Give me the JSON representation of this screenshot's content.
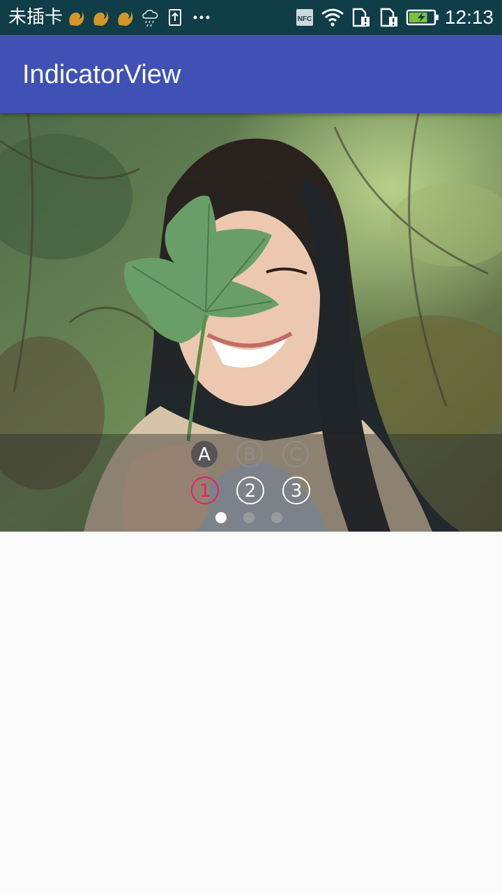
{
  "status_bar": {
    "carrier": "未插卡",
    "time": "12:13",
    "nfc_label": "NFC",
    "icons": [
      "squirrel-app-icon",
      "squirrel-app-icon",
      "squirrel-app-icon",
      "rain-cloud-icon",
      "upload-icon",
      "more-dots-icon",
      "nfc-icon",
      "wifi-icon",
      "sim-alert-icon",
      "sim-alert-icon",
      "battery-charging-icon"
    ],
    "battery_level": 0.75
  },
  "app_bar": {
    "title": "IndicatorView"
  },
  "banner": {
    "letter_indicators": [
      "A",
      "B",
      "C"
    ],
    "letter_selected": 0,
    "number_indicators": [
      "1",
      "2",
      "3"
    ],
    "number_selected": 0,
    "dot_count": 3,
    "dot_selected": 0,
    "colors": {
      "selected_number": "#e91e63",
      "app_bar": "#3f51b5"
    }
  }
}
